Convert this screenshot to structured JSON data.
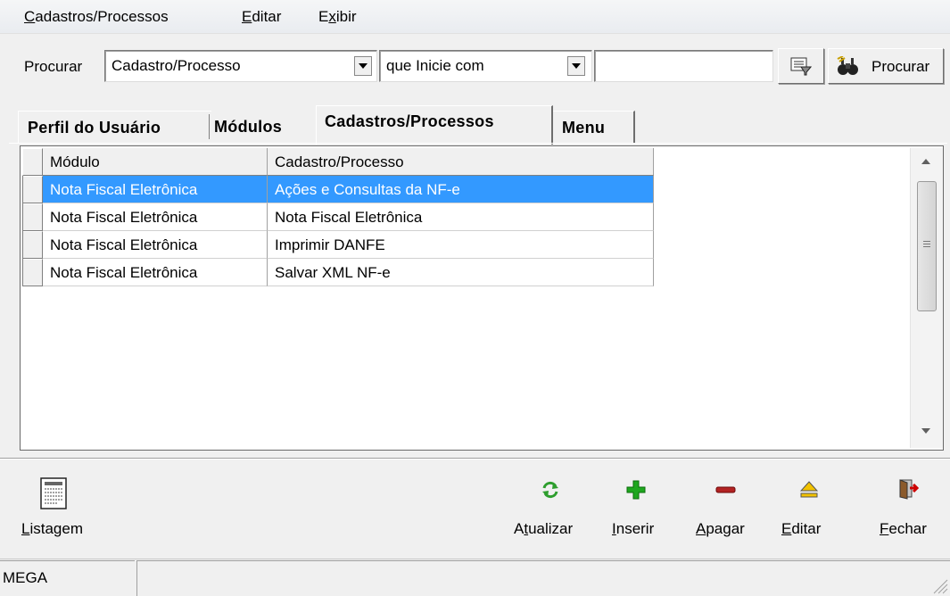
{
  "menu": {
    "items": [
      {
        "label": "Cadastros/Processos",
        "accel": "C"
      },
      {
        "label": "Editar",
        "accel": "d"
      },
      {
        "label": "Exibir",
        "accel": "x"
      }
    ]
  },
  "search": {
    "label": "Procurar",
    "field_value": "Cadastro/Processo",
    "match_value": "que Inicie com",
    "text_value": "",
    "button_label": "Procurar"
  },
  "tabs": [
    {
      "label": "Perfil do Usuário",
      "active": false
    },
    {
      "label": "Módulos",
      "active": false
    },
    {
      "label": "Cadastros/Processos",
      "active": true
    },
    {
      "label": "Menu",
      "active": false
    }
  ],
  "grid": {
    "columns": [
      "Módulo",
      "Cadastro/Processo"
    ],
    "rows": [
      {
        "modulo": "Nota Fiscal Eletrônica",
        "processo": "Ações e Consultas da NF-e",
        "selected": true
      },
      {
        "modulo": "Nota Fiscal Eletrônica",
        "processo": "Nota Fiscal Eletrônica",
        "selected": false
      },
      {
        "modulo": "Nota Fiscal Eletrônica",
        "processo": "Imprimir DANFE",
        "selected": false
      },
      {
        "modulo": "Nota Fiscal Eletrônica",
        "processo": "Salvar XML NF-e",
        "selected": false
      }
    ]
  },
  "toolbar": {
    "listagem": "Listagem",
    "atualizar": "Atualizar",
    "inserir": "Inserir",
    "apagar": "Apagar",
    "editar": "Editar",
    "fechar": "Fechar",
    "icons": [
      "report-icon",
      "refresh-icon",
      "plus-icon",
      "minus-icon",
      "eject-icon",
      "exit-door-icon"
    ]
  },
  "status": {
    "panel1": "MEGA",
    "panel2": ""
  },
  "colors": {
    "selection": "#3399ff",
    "refresh": "#2e9e2e",
    "insert": "#1fa71f",
    "delete": "#b22222"
  }
}
